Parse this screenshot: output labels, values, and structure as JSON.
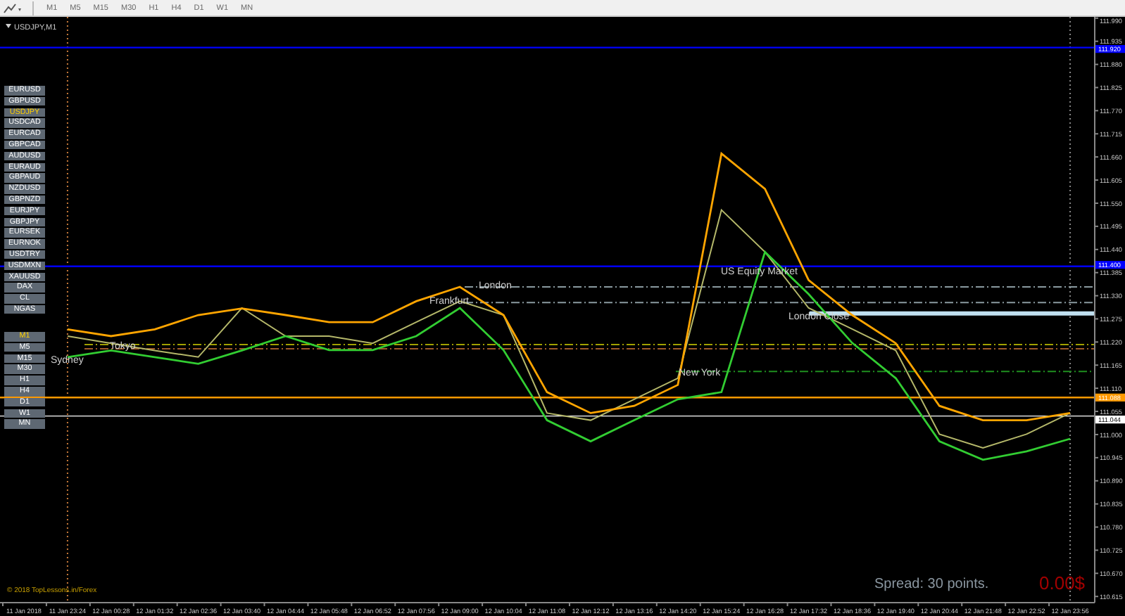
{
  "toolbar": {
    "timeframes": [
      "M1",
      "M5",
      "M15",
      "M30",
      "H1",
      "H4",
      "D1",
      "W1",
      "MN"
    ]
  },
  "chart": {
    "title": "USDJPY,M1",
    "symbols": [
      {
        "label": "EURUSD",
        "selected": false
      },
      {
        "label": "GBPUSD",
        "selected": false
      },
      {
        "label": "USDJPY",
        "selected": true
      },
      {
        "label": "USDCAD",
        "selected": false
      },
      {
        "label": "EURCAD",
        "selected": false
      },
      {
        "label": "GBPCAD",
        "selected": false
      },
      {
        "label": "AUDUSD",
        "selected": false
      },
      {
        "label": "EURAUD",
        "selected": false
      },
      {
        "label": "GBPAUD",
        "selected": false
      },
      {
        "label": "NZDUSD",
        "selected": false
      },
      {
        "label": "GBPNZD",
        "selected": false
      },
      {
        "label": "EURJPY",
        "selected": false
      },
      {
        "label": "GBPJPY",
        "selected": false
      },
      {
        "label": "EURSEK",
        "selected": false
      },
      {
        "label": "EURNOK",
        "selected": false
      },
      {
        "label": "USDTRY",
        "selected": false
      },
      {
        "label": "USDMXN",
        "selected": false
      },
      {
        "label": "XAUUSD",
        "selected": false
      },
      {
        "label": "DAX",
        "selected": false
      },
      {
        "label": "CL",
        "selected": false
      },
      {
        "label": "NGAS",
        "selected": false
      }
    ],
    "timeframes": [
      {
        "label": "M1",
        "selected": true
      },
      {
        "label": "M5",
        "selected": false
      },
      {
        "label": "M15",
        "selected": false
      },
      {
        "label": "M30",
        "selected": false
      },
      {
        "label": "H1",
        "selected": false
      },
      {
        "label": "H4",
        "selected": false
      },
      {
        "label": "D1",
        "selected": false
      },
      {
        "label": "W1",
        "selected": false
      },
      {
        "label": "MN",
        "selected": false
      }
    ],
    "sessions": [
      "Sydney",
      "Tokyo",
      "Frankfurt",
      "London",
      "New York",
      "US Equity Market",
      "London Close"
    ],
    "copyright": "© 2018 TopLessons.in/Forex",
    "spread": "Spread: 30 points.",
    "profit": "0.00$",
    "chart_data": {
      "type": "line",
      "categories": [
        "11 Jan 2018",
        "11 Jan 23:24",
        "12 Jan 00:28",
        "12 Jan 01:32",
        "12 Jan 02:36",
        "12 Jan 03:40",
        "12 Jan 04:44",
        "12 Jan 05:48",
        "12 Jan 06:52",
        "12 Jan 07:56",
        "12 Jan 09:00",
        "12 Jan 10:04",
        "12 Jan 11:08",
        "12 Jan 12:12",
        "12 Jan 13:16",
        "12 Jan 14:20",
        "12 Jan 15:24",
        "12 Jan 16:28",
        "12 Jan 17:32",
        "12 Jan 18:36",
        "12 Jan 19:40",
        "12 Jan 20:44",
        "12 Jan 21:48",
        "12 Jan 22:52",
        "12 Jan 23:56"
      ],
      "series": [
        {
          "color": "#b5b86a",
          "values": [
            null,
            111.234,
            111.217,
            111.2,
            111.184,
            111.301,
            111.234,
            111.234,
            111.217,
            111.267,
            111.317,
            111.284,
            111.051,
            111.034,
            111.084,
            111.134,
            111.534,
            111.434,
            111.301,
            111.251,
            111.2,
            111.001,
            110.968,
            111.001,
            111.051
          ]
        },
        {
          "color": "#ffa500",
          "values": [
            null,
            111.25,
            111.234,
            111.25,
            111.284,
            111.3,
            111.284,
            111.267,
            111.267,
            111.317,
            111.351,
            111.284,
            111.101,
            111.051,
            111.068,
            111.118,
            111.668,
            111.584,
            111.367,
            111.284,
            111.217,
            111.068,
            111.034,
            111.034,
            111.051
          ]
        },
        {
          "color": "#32cd32",
          "values": [
            null,
            111.184,
            111.2,
            111.184,
            111.168,
            111.2,
            111.234,
            111.201,
            111.201,
            111.234,
            111.301,
            111.201,
            111.034,
            110.984,
            111.034,
            111.084,
            111.101,
            111.434,
            111.334,
            111.218,
            111.134,
            110.984,
            110.94,
            110.96,
            110.99
          ]
        }
      ],
      "ref_lines": [
        {
          "axis": "x",
          "value": "11 Jan 23:24",
          "color": "#c87a3a"
        },
        {
          "axis": "x",
          "value": "12 Jan 23:56",
          "color": "#888888"
        },
        {
          "axis": "y",
          "value": 111.92,
          "color": "#0000ff",
          "label": "111.920"
        },
        {
          "axis": "y",
          "value": 111.4,
          "color": "#0000ff",
          "label": "111.400"
        },
        {
          "axis": "y",
          "value": 111.088,
          "color": "#ff9900",
          "label": "111.088"
        },
        {
          "axis": "y",
          "value": 111.044,
          "color": "#ffffff",
          "label": "111.044"
        },
        {
          "axis": "y",
          "value": 111.351,
          "color": "#8a9aa0"
        },
        {
          "axis": "y",
          "value": 111.314,
          "color": "#8a9aa0"
        },
        {
          "axis": "y",
          "value": 111.288,
          "color": "#c0e0f0"
        },
        {
          "axis": "y",
          "value": 111.214,
          "color": "#a0a000"
        },
        {
          "axis": "y",
          "value": 111.204,
          "color": "#a05a2a"
        },
        {
          "axis": "y",
          "value": 111.15,
          "color": "#1f8f1f"
        }
      ],
      "ylim": [
        110.602,
        111.993
      ],
      "yticks": [
        {
          "value": 111.99,
          "label": "111.990"
        },
        {
          "value": 111.935,
          "label": "111.935"
        },
        {
          "value": 111.88,
          "label": "111.880"
        },
        {
          "value": 111.825,
          "label": "111.825"
        },
        {
          "value": 111.77,
          "label": "111.770"
        },
        {
          "value": 111.715,
          "label": "111.715"
        },
        {
          "value": 111.66,
          "label": "111.660"
        },
        {
          "value": 111.605,
          "label": "111.605"
        },
        {
          "value": 111.55,
          "label": "111.550"
        },
        {
          "value": 111.495,
          "label": "111.495"
        },
        {
          "value": 111.44,
          "label": "111.440"
        },
        {
          "value": 111.385,
          "label": "111.385"
        },
        {
          "value": 111.33,
          "label": "111.330"
        },
        {
          "value": 111.275,
          "label": "111.275"
        },
        {
          "value": 111.22,
          "label": "111.220"
        },
        {
          "value": 111.165,
          "label": "111.165"
        },
        {
          "value": 111.11,
          "label": "111.110"
        },
        {
          "value": 111.055,
          "label": "111.055"
        },
        {
          "value": 111.0,
          "label": "111.000"
        },
        {
          "value": 110.945,
          "label": "110.945"
        },
        {
          "value": 110.89,
          "label": "110.890"
        },
        {
          "value": 110.835,
          "label": "110.835"
        },
        {
          "value": 110.78,
          "label": "110.780"
        },
        {
          "value": 110.725,
          "label": "110.725"
        },
        {
          "value": 110.67,
          "label": "110.670"
        },
        {
          "value": 110.615,
          "label": "110.615"
        }
      ]
    }
  }
}
